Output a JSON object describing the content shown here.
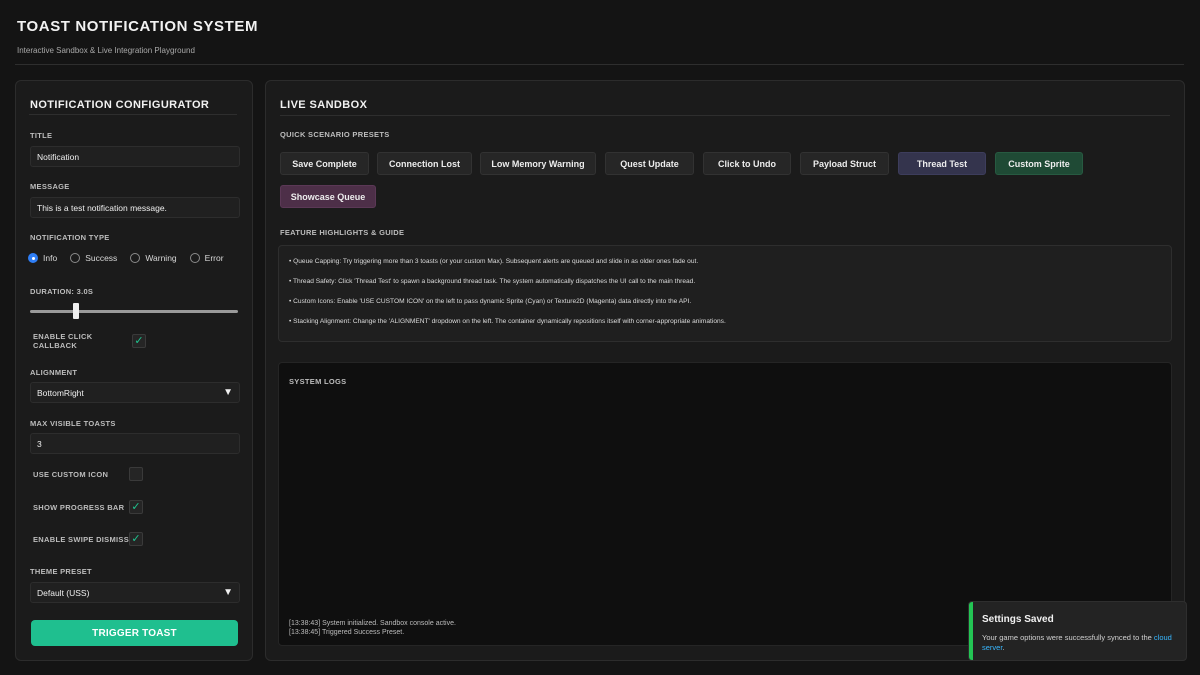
{
  "app": {
    "title": "TOAST NOTIFICATION SYSTEM",
    "subtitle": "Interactive Sandbox & Live Integration Playground"
  },
  "configurator": {
    "heading": "NOTIFICATION CONFIGURATOR",
    "title_label": "TITLE",
    "title_value": "Notification",
    "message_label": "MESSAGE",
    "message_value": "This is a test notification message.",
    "type_label": "NOTIFICATION TYPE",
    "types": [
      {
        "label": "Info",
        "selected": true
      },
      {
        "label": "Success",
        "selected": false
      },
      {
        "label": "Warning",
        "selected": false
      },
      {
        "label": "Error",
        "selected": false
      }
    ],
    "duration_label": "DURATION: 3.0s",
    "duration_fraction": 0.22,
    "click_callback_label": "ENABLE CLICK CALLBACK",
    "click_callback_checked": true,
    "alignment_label": "ALIGNMENT",
    "alignment_value": "BottomRight",
    "max_visible_label": "MAX VISIBLE TOASTS",
    "max_visible_value": "3",
    "custom_icon_label": "USE CUSTOM ICON",
    "custom_icon_checked": false,
    "progress_bar_label": "SHOW PROGRESS BAR",
    "progress_bar_checked": true,
    "swipe_dismiss_label": "ENABLE SWIPE DISMISS",
    "swipe_dismiss_checked": true,
    "theme_label": "THEME PRESET",
    "theme_value": "Default (USS)",
    "trigger_label": "TRIGGER TOAST",
    "check_glyph": "✓",
    "select_glyph": "▼"
  },
  "sandbox": {
    "heading": "LIVE SANDBOX",
    "presets_label": "QUICK SCENARIO PRESETS",
    "presets": [
      "Save Complete",
      "Connection Lost",
      "Low Memory Warning",
      "Quest Update",
      "Click to Undo",
      "Payload Struct",
      "Thread Test",
      "Custom Sprite",
      "Showcase Queue"
    ],
    "guide_label": "FEATURE HIGHLIGHTS & GUIDE",
    "guide_items": [
      "• Queue Capping: Try triggering more than 3 toasts (or your custom Max). Subsequent alerts are queued and slide in as older ones fade out.",
      "• Thread Safety: Click 'Thread Test' to spawn a background thread task. The system automatically dispatches the UI call to the main thread.",
      "• Custom Icons: Enable 'USE CUSTOM ICON' on the left to pass dynamic Sprite (Cyan) or Texture2D (Magenta) data directly into the API.",
      "• Stacking Alignment: Change the 'ALIGNMENT' dropdown on the left. The container dynamically repositions itself with corner-appropriate animations."
    ],
    "logs_label": "SYSTEM LOGS",
    "logs": [
      "[13:38:43] System initialized. Sandbox console active.",
      "[13:38:45] Triggered Success Preset."
    ]
  },
  "toast": {
    "title": "Settings Saved",
    "body": "Your game options were successfully synced to the",
    "link": "cloud server",
    "tail": ".",
    "accent": "#23c554"
  },
  "colors": {
    "accent_primary": "#1fbf8f",
    "radio_selected": "#2f7ef5",
    "thread_btn": "#34344d",
    "sprite_btn": "#1f4a35",
    "showcase_btn": "#4d2f48",
    "toast_link": "#38b7ff"
  }
}
